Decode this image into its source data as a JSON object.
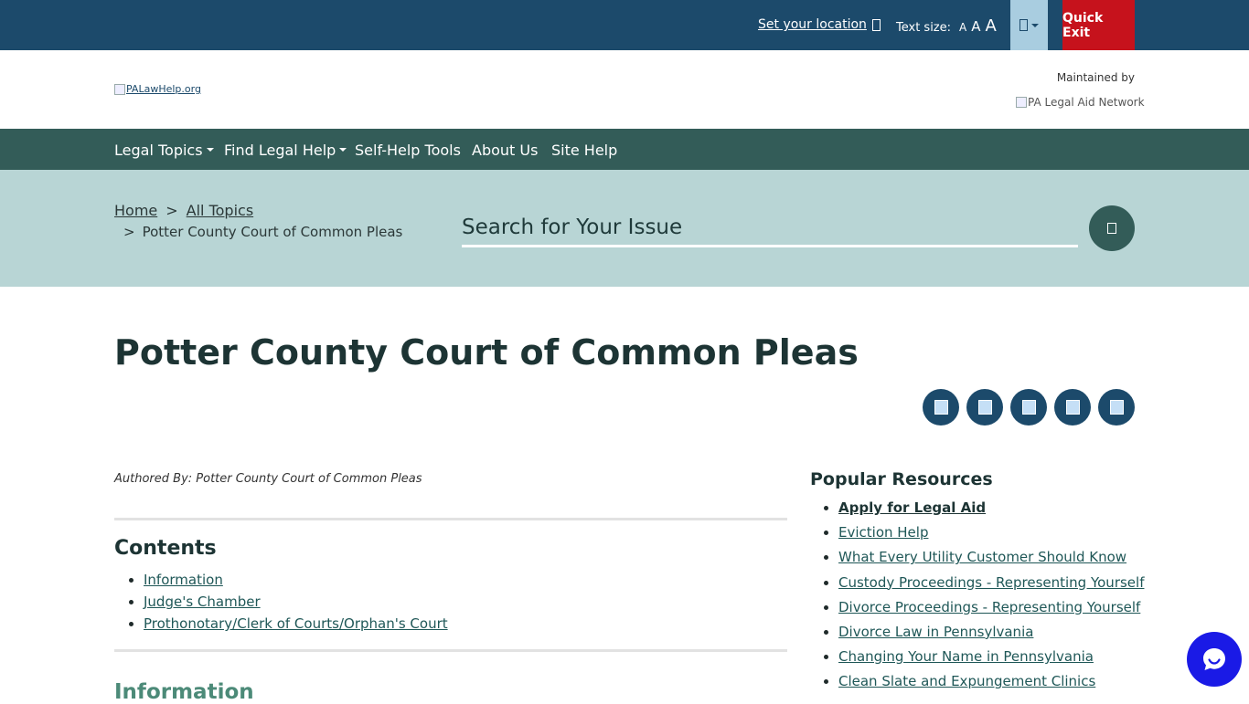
{
  "topbar": {
    "location_label": "Set your location",
    "text_size_label": "Text size:",
    "text_size_options": [
      "A",
      "A",
      "A"
    ],
    "quick_exit_label": "Quick Exit"
  },
  "header": {
    "logo_alt": "PALawHelp.org",
    "maintained_by": "Maintained by",
    "network_alt": "PA Legal Aid Network"
  },
  "nav": {
    "items": [
      {
        "label": "Legal Topics",
        "dropdown": true
      },
      {
        "label": "Find Legal Help",
        "dropdown": true
      },
      {
        "label": "Self-Help Tools",
        "dropdown": false
      },
      {
        "label": "About Us",
        "dropdown": false
      },
      {
        "label": "Site Help",
        "dropdown": false
      }
    ]
  },
  "breadcrumb": {
    "home": "Home",
    "all_topics": "All Topics",
    "current": "Potter County Court of Common Pleas",
    "separator": ">"
  },
  "search": {
    "label": "Search for Your Issue"
  },
  "page": {
    "title": "Potter County Court of Common Pleas",
    "authored_by": "Authored By: Potter County Court of Common Pleas"
  },
  "share_icons": [
    "facebook-share-icon",
    "twitter-share-icon",
    "linkedin-share-icon",
    "email-share-icon",
    "print-share-icon"
  ],
  "contents": {
    "title": "Contents",
    "items": [
      "Information",
      "Judge's Chamber",
      "Prothonotary/Clerk of Courts/Orphan's Court"
    ]
  },
  "information_heading": "Information",
  "popular": {
    "title": "Popular Resources",
    "items": [
      "Apply for Legal Aid",
      "Eviction Help",
      "What Every Utility Customer Should Know",
      "Custody Proceedings - Representing Yourself",
      "Divorce Proceedings - Representing Yourself",
      "Divorce Law in Pennsylvania",
      "Changing Your Name in Pennsylvania",
      "Clean Slate and Expungement Clinics"
    ]
  },
  "colors": {
    "topbar": "#1c4a6b",
    "nav": "#335c58",
    "band": "#b8d5d5",
    "quick_exit": "#c6121c",
    "chat": "#1a1ae6"
  }
}
